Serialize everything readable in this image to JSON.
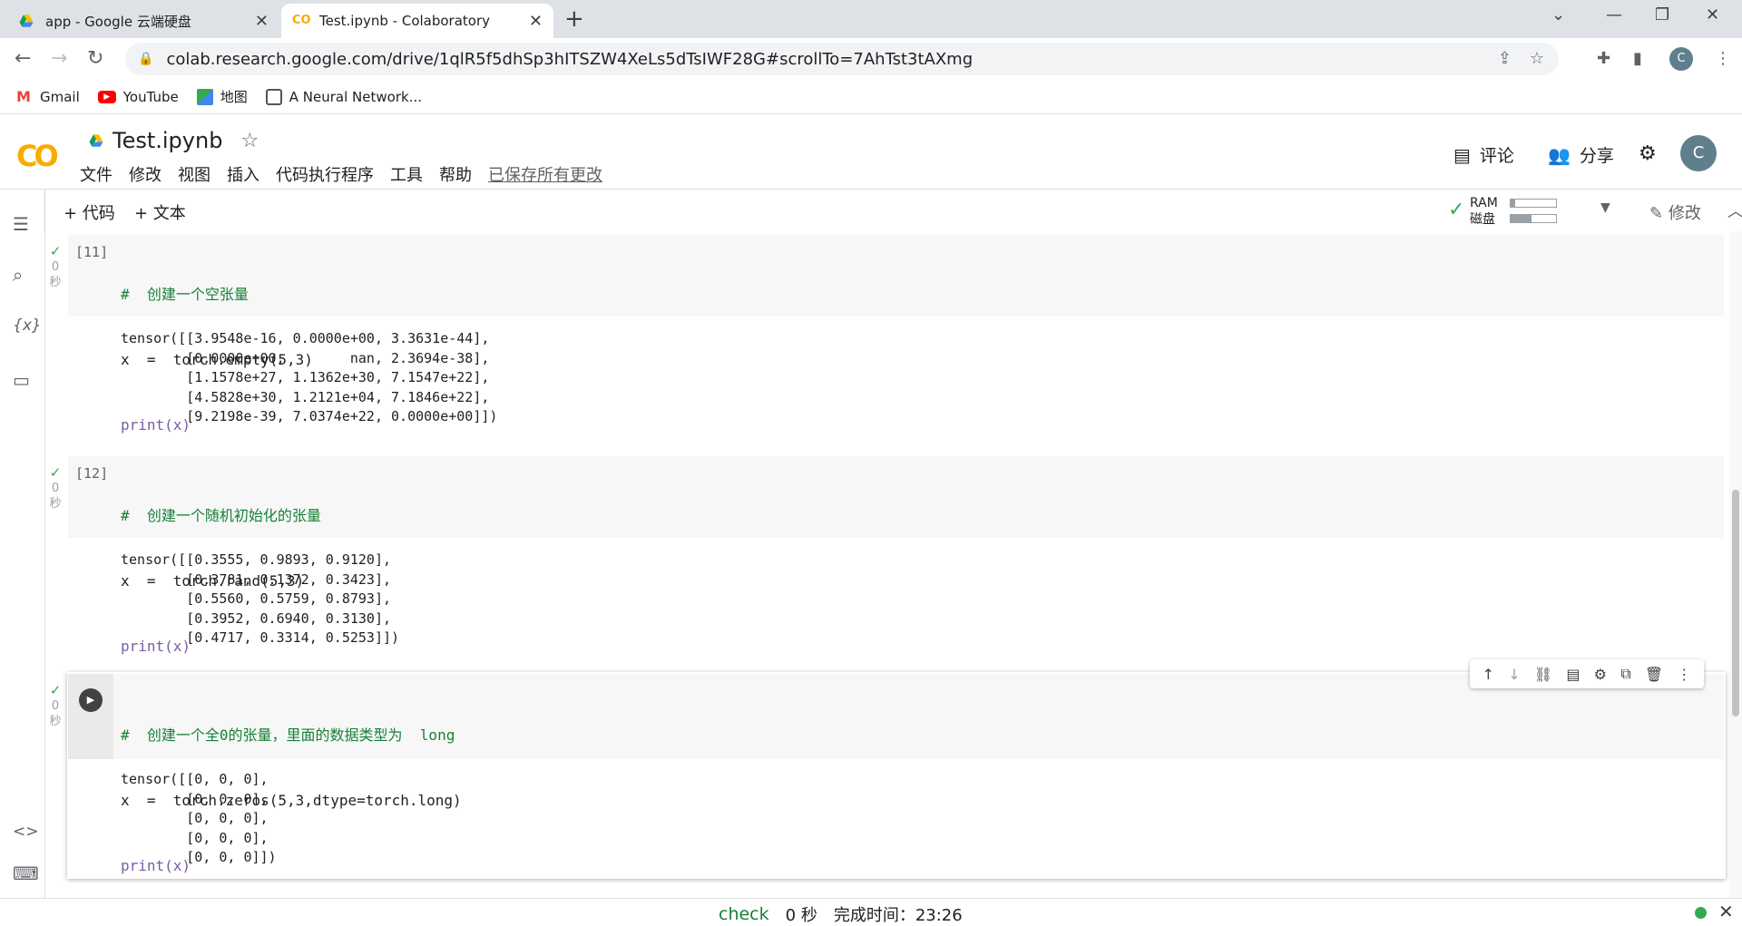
{
  "browser": {
    "tabs": [
      {
        "title": "app - Google 云端硬盘",
        "active": false
      },
      {
        "title": "Test.ipynb - Colaboratory",
        "active": true
      }
    ],
    "url": "colab.research.google.com/drive/1qlR5f5dhSp3hITSZW4XeLs5dTsIWF28G#scrollTo=7AhTst3tAXmg",
    "profile_initial": "C",
    "bookmarks": [
      {
        "label": "Gmail",
        "icon": "gmail-icon"
      },
      {
        "label": "YouTube",
        "icon": "youtube-icon"
      },
      {
        "label": "地图",
        "icon": "maps-icon"
      },
      {
        "label": "A Neural Network...",
        "icon": "neural-network-icon"
      }
    ]
  },
  "colab": {
    "notebook_title": "Test.ipynb",
    "menu": [
      "文件",
      "修改",
      "视图",
      "插入",
      "代码执行程序",
      "工具",
      "帮助"
    ],
    "saved_status": "已保存所有更改",
    "comment_label": "评论",
    "share_label": "分享",
    "avatar_initial": "C",
    "add_code_label": "+ 代码",
    "add_text_label": "+ 文本",
    "ram_label": "RAM",
    "disk_label": "磁盘",
    "ram_usage": 0.1,
    "disk_usage": 0.45,
    "edit_label": "修改"
  },
  "cells": [
    {
      "prompt": "[11]",
      "exec_time": "0",
      "exec_unit": "秒",
      "code_comment": "#  创建一个空张量",
      "code_line2": "x  =  torch.empty(5,3)",
      "code_line3": "print(x)",
      "output": "tensor([[3.9548e-16, 0.0000e+00, 3.3631e-44],\n        [0.0000e+00,        nan, 2.3694e-38],\n        [1.1578e+27, 1.1362e+30, 7.1547e+22],\n        [4.5828e+30, 1.2121e+04, 7.1846e+22],\n        [9.2198e-39, 7.0374e+22, 0.0000e+00]])"
    },
    {
      "prompt": "[12]",
      "exec_time": "0",
      "exec_unit": "秒",
      "code_comment": "#  创建一个随机初始化的张量",
      "code_line2": "x  =  torch.rand(5,3)",
      "code_line3": "print(x)",
      "output": "tensor([[0.3555, 0.9893, 0.9120],\n        [0.3781, 0.1372, 0.3423],\n        [0.5560, 0.5759, 0.8793],\n        [0.3952, 0.6940, 0.3130],\n        [0.4717, 0.3314, 0.5253]])"
    },
    {
      "prompt": "",
      "exec_time": "0",
      "exec_unit": "秒",
      "code_comment": "#  创建一个全0的张量，里面的数据类型为  long",
      "code_line2": "x  =  torch.zeros(5,3,dtype=torch.long)",
      "code_line3": "print(x)",
      "output": "tensor([[0, 0, 0],\n        [0, 0, 0],\n        [0, 0, 0],\n        [0, 0, 0],\n        [0, 0, 0]])"
    }
  ],
  "statusbar": {
    "check_label": "check",
    "duration": "0 秒",
    "completed": "完成时间：23:26"
  }
}
